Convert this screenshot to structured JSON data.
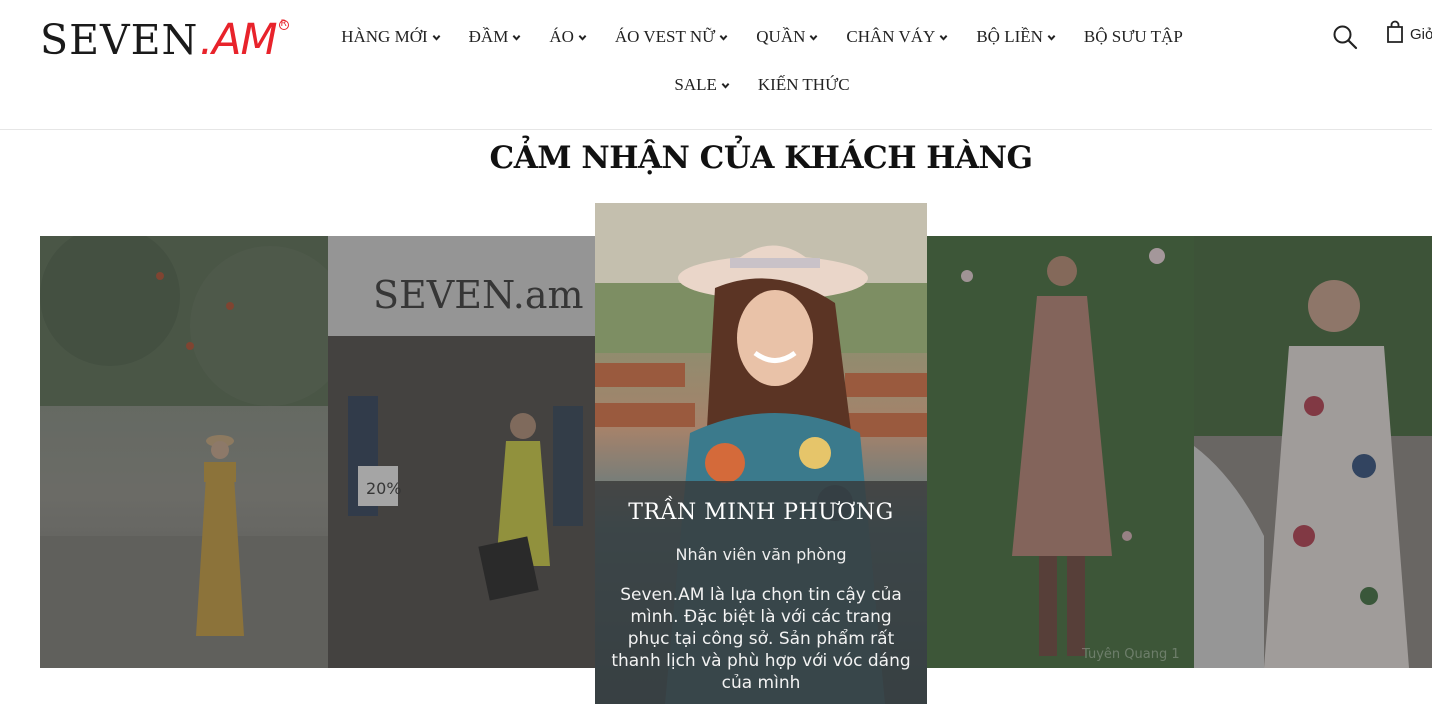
{
  "header": {
    "logo": {
      "brand": "SEVEN",
      "suffix": ".AM",
      "reg_mark": "R"
    },
    "nav": [
      {
        "label": "HÀNG MỚI",
        "has_dropdown": true
      },
      {
        "label": "ĐẦM",
        "has_dropdown": true
      },
      {
        "label": "ÁO",
        "has_dropdown": true
      },
      {
        "label": "ÁO VEST NỮ",
        "has_dropdown": true
      },
      {
        "label": "QUẦN",
        "has_dropdown": true
      },
      {
        "label": "CHÂN VÁY",
        "has_dropdown": true
      },
      {
        "label": "BỘ LIỀN",
        "has_dropdown": true
      },
      {
        "label": "BỘ SƯU TẬP",
        "has_dropdown": false
      },
      {
        "label": "SALE",
        "has_dropdown": true
      },
      {
        "label": "KIẾN THỨC",
        "has_dropdown": false
      }
    ],
    "search_icon": "search-icon",
    "cart_icon": "shopping-bag-icon",
    "cart_label": "Giỏ"
  },
  "section": {
    "title": "CẢM NHẬN CỦA KHÁCH HÀNG"
  },
  "testimonials": {
    "active": {
      "name": "TRẦN MINH PHƯƠNG",
      "role": "Nhân viên văn phòng",
      "quote": "Seven.AM là lựa chọn tin cậy của mình. Đặc biệt là với các trang phục tại công sở. Sản phẩm rất thanh lịch và phù hợp với vóc dáng của mình"
    },
    "store_sign": "SEVEN.am",
    "store_discount": "20%",
    "watermark": "Tuyên Quang 1"
  },
  "colors": {
    "brand_red": "#e8232b",
    "text_dark": "#222222",
    "caption_bg": "rgba(55,55,55,0.78)"
  }
}
